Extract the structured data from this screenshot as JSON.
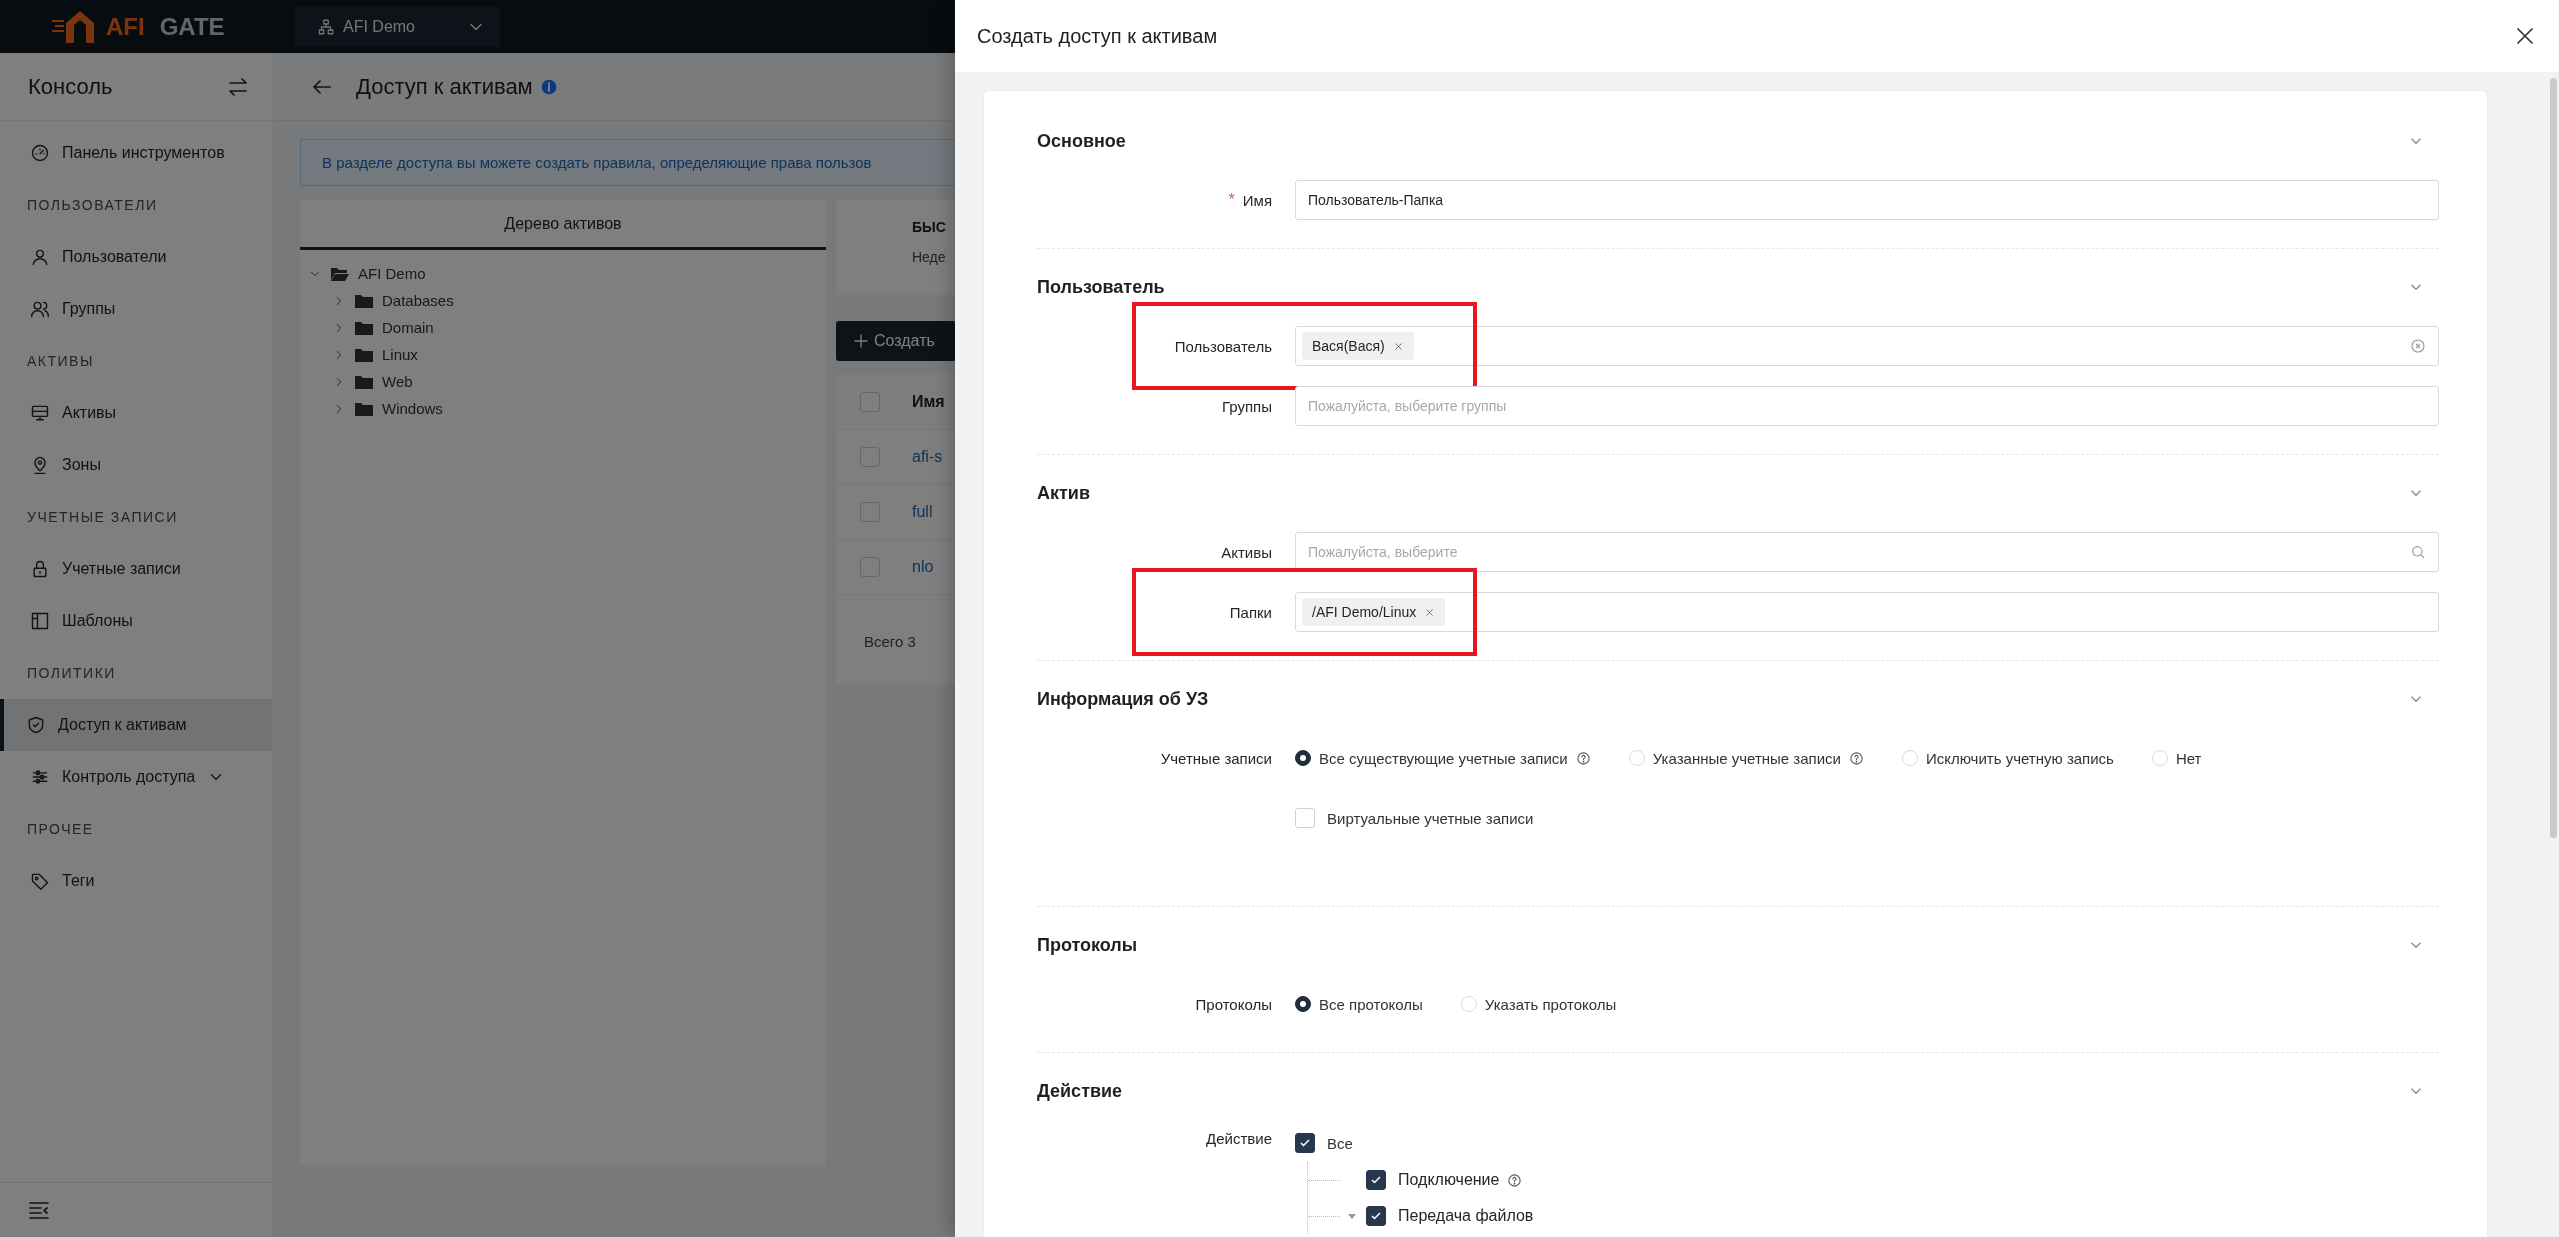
{
  "header": {
    "logo_brand": "AFI",
    "logo_product": "GATE",
    "org_selector": "AFI Demo"
  },
  "sidebar": {
    "title": "Консоль",
    "groups": [
      {
        "items": [
          {
            "label": "Панель инструментов",
            "kind": "link",
            "selected": false
          }
        ]
      },
      {
        "heading": "ПОЛЬЗОВАТЕЛИ",
        "items": [
          {
            "label": "Пользователи",
            "kind": "link",
            "selected": false
          },
          {
            "label": "Группы",
            "kind": "link",
            "selected": false
          }
        ]
      },
      {
        "heading": "АКТИВЫ",
        "items": [
          {
            "label": "Активы",
            "kind": "link",
            "selected": false
          },
          {
            "label": "Зоны",
            "kind": "link",
            "selected": false
          }
        ]
      },
      {
        "heading": "УЧЕТНЫЕ ЗАПИСИ",
        "items": [
          {
            "label": "Учетные записи",
            "kind": "link",
            "selected": false
          },
          {
            "label": "Шаблоны",
            "kind": "link",
            "selected": false
          }
        ]
      },
      {
        "heading": "ПОЛИТИКИ",
        "items": [
          {
            "label": "Доступ к активам",
            "kind": "link",
            "selected": true
          },
          {
            "label": "Контроль доступа",
            "kind": "submenu",
            "selected": false,
            "expanded": false
          }
        ]
      },
      {
        "heading": "ПРОЧЕЕ",
        "items": [
          {
            "label": "Теги",
            "kind": "link",
            "selected": false
          }
        ]
      }
    ]
  },
  "page": {
    "title": "Доступ к активам",
    "banner": "В разделе доступа вы можете создать правила, определяющие права пользов",
    "tree_tab": "Дерево активов",
    "tree": [
      {
        "label": "AFI Demo",
        "expanded": true,
        "children": [
          {
            "label": "Databases",
            "expanded": false
          },
          {
            "label": "Domain",
            "expanded": false
          },
          {
            "label": "Linux",
            "expanded": false
          },
          {
            "label": "Web",
            "expanded": false
          },
          {
            "label": "Windows",
            "expanded": false
          }
        ]
      }
    ],
    "quick_card": {
      "title": "БЫС",
      "subtitle": "Неде"
    },
    "create_button": "Создать",
    "table": {
      "columns": [
        "Имя"
      ],
      "header_checked": false,
      "rows": [
        {
          "name": "afi-s",
          "checked": false
        },
        {
          "name": "full",
          "checked": false
        },
        {
          "name": "nlo",
          "checked": false
        }
      ]
    },
    "total": "Всего 3"
  },
  "drawer": {
    "title": "Создать доступ к активам",
    "sections": [
      {
        "title": "Основное",
        "expanded": true,
        "rows": [
          {
            "kind": "text",
            "label": "Имя",
            "required_mark": "*",
            "highlighted": false,
            "value": "Пользователь-Папка"
          }
        ]
      },
      {
        "title": "Пользователь",
        "expanded": true,
        "rows": [
          {
            "kind": "tags",
            "label": "Пользователь",
            "highlighted": true,
            "tags": [
              "Вася(Вася)"
            ],
            "clearable": true
          },
          {
            "kind": "select",
            "label": "Группы",
            "highlighted": false,
            "placeholder": "Пожалуйста, выберите группы",
            "searchable": false
          }
        ]
      },
      {
        "title": "Актив",
        "expanded": true,
        "rows": [
          {
            "kind": "select",
            "label": "Активы",
            "highlighted": false,
            "placeholder": "Пожалуйста, выберите",
            "searchable": true
          },
          {
            "kind": "tags",
            "label": "Папки",
            "highlighted": true,
            "tags": [
              "/AFI Demo/Linux"
            ],
            "clearable": false
          }
        ]
      },
      {
        "title": "Информация об УЗ",
        "expanded": true,
        "rows": [
          {
            "kind": "radio",
            "label": "Учетные записи",
            "highlighted": false,
            "options": [
              {
                "label": "Все существующие учетные записи",
                "selected": true,
                "help": true
              },
              {
                "label": "Указанные учетные записи",
                "selected": false,
                "help": true
              },
              {
                "label": "Исключить учетную запись",
                "selected": false,
                "help": false
              },
              {
                "label": "Нет",
                "selected": false,
                "help": false
              }
            ]
          },
          {
            "kind": "checkbox",
            "text": "Виртуальные учетные записи",
            "checked": false
          }
        ]
      },
      {
        "title": "Протоколы",
        "expanded": true,
        "rows": [
          {
            "kind": "radio",
            "label": "Протоколы",
            "highlighted": false,
            "options": [
              {
                "label": "Все протоколы",
                "selected": true,
                "help": false
              },
              {
                "label": "Указать протоколы",
                "selected": false,
                "help": false
              }
            ]
          }
        ]
      },
      {
        "title": "Действие",
        "expanded": true,
        "rows": [
          {
            "kind": "checktree",
            "label": "Действие",
            "highlighted": false,
            "items": [
              {
                "label": "Все",
                "checked": true,
                "help": false,
                "children": [
                  {
                    "label": "Подключение",
                    "checked": true,
                    "help": true
                  },
                  {
                    "label": "Передача файлов",
                    "checked": true,
                    "help": false,
                    "expanded": true
                  }
                ]
              }
            ]
          }
        ]
      }
    ]
  }
}
